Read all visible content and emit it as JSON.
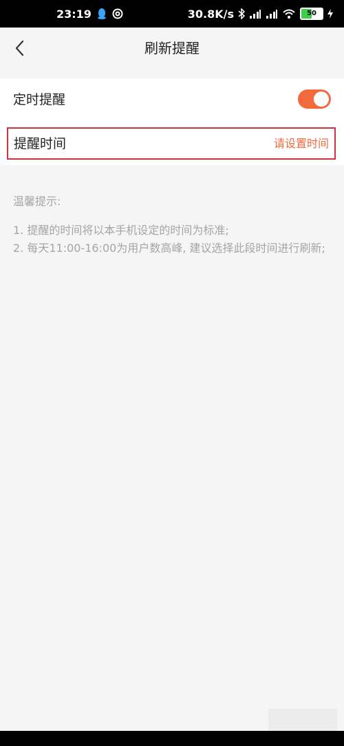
{
  "status_bar": {
    "time": "23:19",
    "net_speed": "30.8K/s",
    "battery": "50",
    "battery_level": 0.5,
    "icons": [
      "qq-penguin-icon",
      "vpn-icon",
      "bluetooth-icon",
      "signal-hd-icon",
      "signal-hd-icon",
      "wifi-icon",
      "battery-icon",
      "charging-icon"
    ]
  },
  "header": {
    "title": "刷新提醒",
    "back_icon": "chevron-left-icon"
  },
  "settings": {
    "timer_label": "定时提醒",
    "timer_enabled": true,
    "time_label": "提醒时间",
    "time_value": "请设置时间"
  },
  "tips": {
    "title": "温馨提示:",
    "items": [
      "1. 提醒的时间将以本手机设定的时间为标准;",
      "2. 每天11:00-16:00为用户数高峰, 建议选择此段时间进行刷新;"
    ]
  },
  "colors": {
    "accent": "#f26a3b",
    "highlight_border": "#d0323c",
    "background": "#f5f5f5"
  }
}
